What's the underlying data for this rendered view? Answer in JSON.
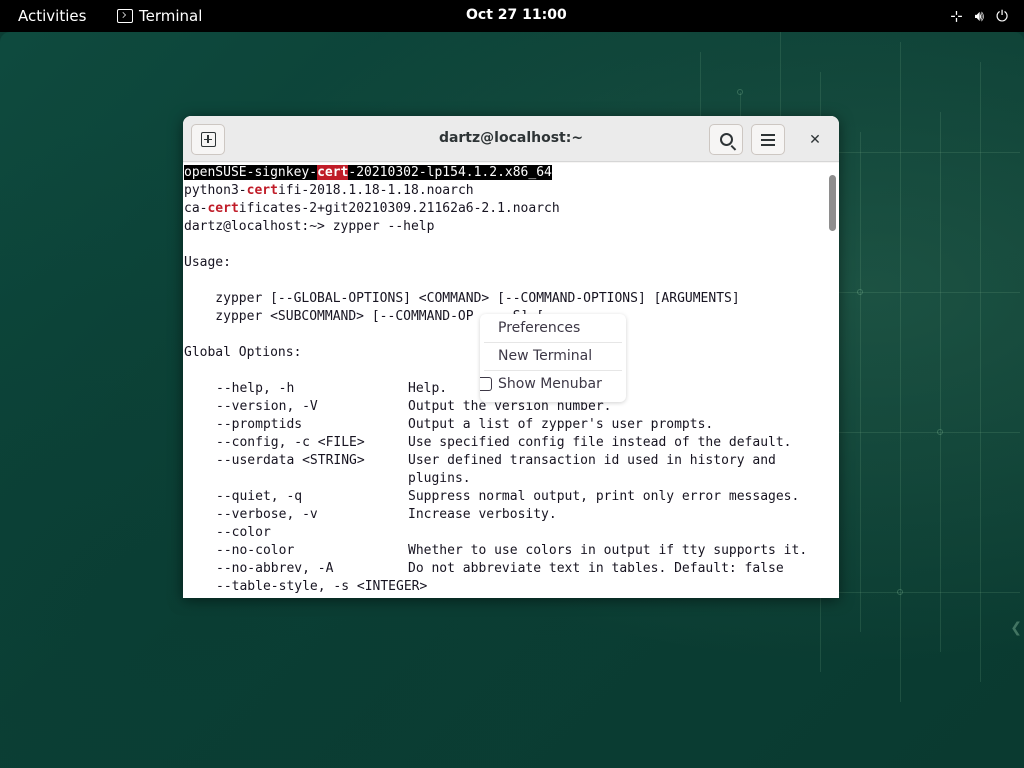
{
  "topbar": {
    "activities": "Activities",
    "app_name": "Terminal",
    "clock": "Oct 27  11:00",
    "network_icon": "network-icon",
    "volume_icon": "volume-icon",
    "power_icon": "power-icon"
  },
  "window": {
    "title": "dartz@localhost:~",
    "new_tab_icon": "new-tab-icon",
    "search_icon": "search-icon",
    "menu_icon": "hamburger-menu-icon",
    "close_glyph": "✕"
  },
  "terminal": {
    "line1": {
      "pre": "openSUSE-signkey-",
      "match": "cert",
      "post": "-20210302-lp154.1.2.x86_64"
    },
    "line2": {
      "pre": "python3-",
      "match": "cert",
      "post": "ifi-2018.1.18-1.18.noarch"
    },
    "line3": {
      "pre": "ca-",
      "match": "cert",
      "post": "ificates-2+git20210309.21162a6-2.1.noarch"
    },
    "prompt": "dartz@localhost:~> zypper --help",
    "usage": "Usage:",
    "usage1": "    zypper [--GLOBAL-OPTIONS] <COMMAND> [--COMMAND-OPTIONS] [ARGUMENTS]",
    "usage2": "    zypper <SUBCOMMAND> [--COMMAND-OP     S] [",
    "global": "Global Options:",
    "options": [
      {
        "opt": "--help, -h",
        "desc": "Help."
      },
      {
        "opt": "--version, -V",
        "desc": "Output the version number."
      },
      {
        "opt": "--promptids",
        "desc": "Output a list of zypper's user prompts."
      },
      {
        "opt": "--config, -c <FILE>",
        "desc": "Use specified config file instead of the default."
      },
      {
        "opt": "--userdata <STRING>",
        "desc": "User defined transaction id used in history and"
      },
      {
        "opt": "",
        "desc": "plugins."
      },
      {
        "opt": "--quiet, -q",
        "desc": "Suppress normal output, print only error messages."
      },
      {
        "opt": "--verbose, -v",
        "desc": "Increase verbosity."
      },
      {
        "opt": "--color",
        "desc": ""
      },
      {
        "opt": "--no-color",
        "desc": "Whether to use colors in output if tty supports it."
      },
      {
        "opt": "--no-abbrev, -A",
        "desc": "Do not abbreviate text in tables. Default: false"
      },
      {
        "opt": "--table-style, -s <INTEGER>",
        "desc": ""
      }
    ]
  },
  "context_menu": {
    "preferences": "Preferences",
    "new_terminal": "New Terminal",
    "show_menubar": "Show Menubar",
    "show_menubar_checked": false
  }
}
